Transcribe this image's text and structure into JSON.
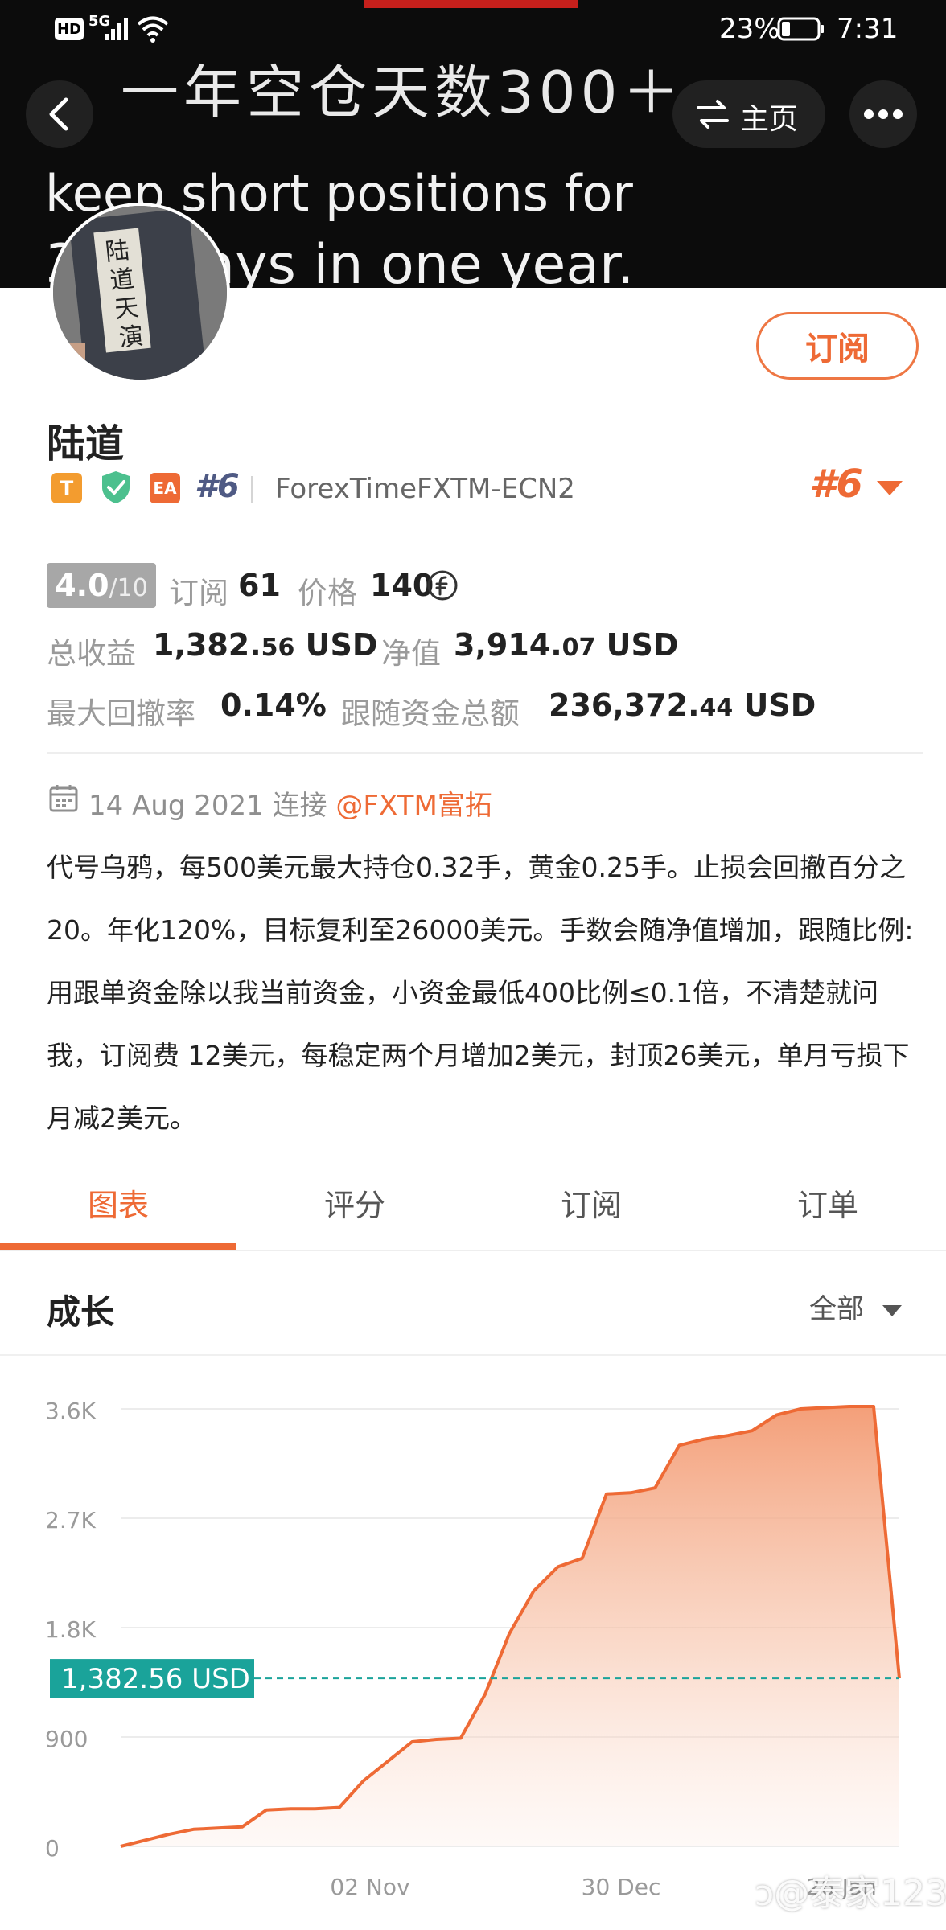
{
  "status_bar": {
    "hd": "HD",
    "net": "5G",
    "battery": "23%",
    "time": "7:31"
  },
  "banner": {
    "cn_text": "一年空仓天数300＋",
    "en_line1": "keep  short positions for",
    "en_line2": "300 days in one year."
  },
  "header": {
    "home_label": "主页"
  },
  "profile": {
    "subscribe_label": "订阅",
    "name": "陆道",
    "badge_t": "T",
    "badge_ea": "EA",
    "rank_small": "#6",
    "broker": "ForexTimeFXTM-ECN2",
    "rank_big": "#6"
  },
  "stats": {
    "rating_main": "4.0",
    "rating_den": "/10",
    "subs_label": "订阅",
    "subs_value": "61",
    "price_label": "价格",
    "price_value": "140",
    "profit_label": "总收益",
    "profit_int": "1,382.",
    "profit_dec": "56",
    "profit_unit": " USD",
    "equity_label": "净值",
    "equity_int": "3,914.",
    "equity_dec": "07",
    "equity_unit": " USD",
    "drawdown_label": "最大回撤率",
    "drawdown_value": "0.14%",
    "follow_label": "跟随资金总额",
    "follow_int": "236,372.",
    "follow_dec": "44",
    "follow_unit": " USD"
  },
  "connect": {
    "date": "14 Aug 2021",
    "connect_word": "连接",
    "handle": "@FXTM富拓"
  },
  "description": "代号乌鸦，每500美元最大持仓0.32手，黄金0.25手。止损会回撤百分之20。年化120%，目标复利至26000美元。手数会随净值增加，跟随比例:用跟单资金除以我当前资金，小资金最低400比例≤0.1倍，不清楚就问我，订阅费 12美元，每稳定两个月增加2美元，封顶26美元，单月亏损下月减2美元。",
  "tabs": [
    "图表",
    "评分",
    "订阅",
    "订单"
  ],
  "growth": {
    "title": "成长",
    "range": "全部"
  },
  "watermark": "ↄ@泰家123",
  "colors": {
    "accent": "#ee6a35",
    "current_line": "#1aa39a",
    "badge_t": "#f39c2f",
    "badge_shield": "#4cc08e",
    "badge_ea": "#ee6a35"
  },
  "chart_data": {
    "type": "area",
    "title": "",
    "xlabel": "",
    "ylabel": "",
    "ylim": [
      0,
      3600
    ],
    "y_ticks": [
      0,
      900,
      1800,
      2700,
      3600
    ],
    "y_tick_labels": [
      "0",
      "900",
      "1.8K",
      "2.7K",
      "3.6K"
    ],
    "x_tick_labels": [
      "02 Nov",
      "30 Dec",
      "26 Jan"
    ],
    "current_value": 1382.56,
    "current_label": "1,382.56 USD",
    "series": [
      {
        "values": [
          0,
          50,
          100,
          140,
          150,
          160,
          300,
          310,
          310,
          320,
          540,
          700,
          860,
          880,
          890,
          1250,
          1750,
          2100,
          2300,
          2370,
          2900,
          2910,
          2950,
          3300,
          3350,
          3380,
          3420,
          3550,
          3600,
          3610,
          3620,
          3620,
          1382.56
        ]
      }
    ]
  }
}
